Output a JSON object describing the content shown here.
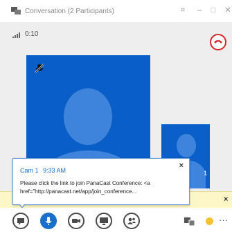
{
  "window": {
    "title": "Conversation (2 Participants)",
    "icons": {
      "app": "conversation-app-icon",
      "snap": "snap-icon",
      "minimize": "minimize-icon",
      "maximize": "maximize-icon",
      "close": "close-icon"
    }
  },
  "call": {
    "duration": "0:10",
    "icons": {
      "signal": "signal-strength-icon",
      "hangup": "hang-up-icon",
      "mic_muted": "microphone-muted-icon"
    },
    "pip_label": "1"
  },
  "toast": {
    "sender": "Cam 1",
    "time": "9:33 AM",
    "message": "Please click the link to join PanaCast Conference: <a href=\"http://panacast.net/app/join_conference...",
    "close_glyph": "×"
  },
  "notification_bar": {
    "close_glyph": "×"
  },
  "toolbar": {
    "buttons": [
      "im-icon",
      "microphone-icon",
      "video-camera-icon",
      "present-icon",
      "participants-icon"
    ],
    "right": [
      "devices-icon",
      "emoji-icon",
      "more-options-icon"
    ],
    "more_glyph": "···"
  },
  "colors": {
    "accent": "#1a6fc9",
    "video_bg": "#0a5ec8",
    "hangup": "#d9262b",
    "notification": "#fdf6c6"
  }
}
